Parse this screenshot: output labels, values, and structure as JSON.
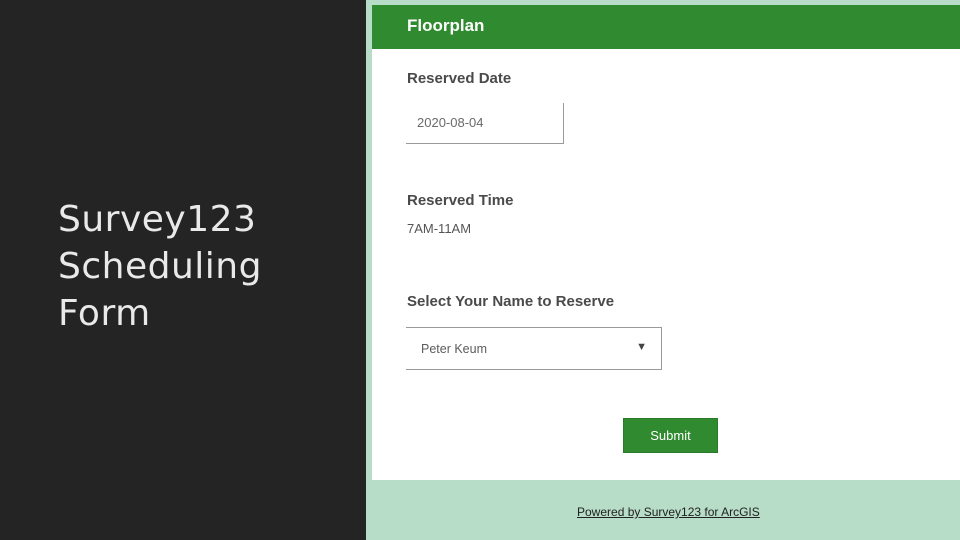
{
  "slide": {
    "title_lines": [
      "Survey123",
      "Scheduling",
      "Form"
    ]
  },
  "form": {
    "title": "Floorplan",
    "reserved_date": {
      "label": "Reserved Date",
      "value": "2020-08-04"
    },
    "reserved_time": {
      "label": "Reserved Time",
      "value": "7AM-11AM"
    },
    "select_name": {
      "label": "Select Your Name to Reserve",
      "value": "Peter Keum"
    },
    "submit_label": "Submit"
  },
  "footer": {
    "powered_by": "Powered by Survey123 for ArcGIS"
  },
  "colors": {
    "header_green": "#308a2f",
    "footer_mint": "#b7dcc7",
    "dark_panel": "#242424"
  },
  "icons": {
    "select_caret": "caret-down-icon"
  }
}
